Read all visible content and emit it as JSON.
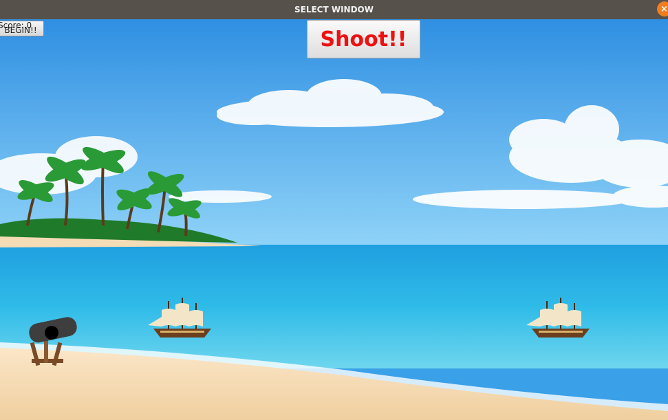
{
  "window": {
    "title": "SELECT WINDOW",
    "close_glyph": "×"
  },
  "hud": {
    "score_text": "Score: 0"
  },
  "controls": {
    "begin_label": "BEGIN!!",
    "shoot_label": "Shoot!!"
  },
  "sprites": {
    "cannon": "cannon-icon",
    "ship": "pirate-ship-icon"
  },
  "colors": {
    "sky_top": "#2f92e4",
    "sky_bottom": "#8ad0f7",
    "sea": "#29b7e6",
    "sand": "#f4d8b0",
    "shoot_text": "#ee1111",
    "titlebar": "#57514b"
  }
}
